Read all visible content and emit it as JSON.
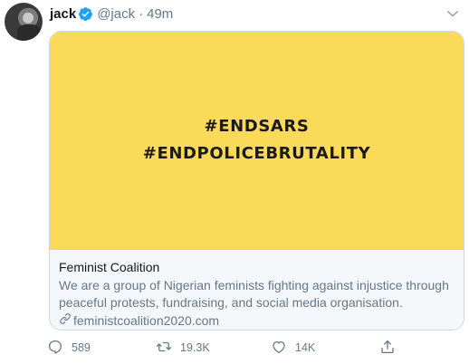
{
  "tweet": {
    "author_name": "jack",
    "handle": "@jack",
    "separator": "·",
    "time": "49m"
  },
  "card": {
    "image_lines": [
      "#ENDSARS",
      "#ENDPOLICEBRUTALITY"
    ],
    "image_bg": "#fbda5a",
    "title": "Feminist Coalition",
    "description_line1": "We are a group of Nigerian feminists fighting against injustice through",
    "description_line2": "peaceful protests, fundraising, and social media organisation.",
    "link": "feministcoalition2020.com"
  },
  "actions": {
    "reply_count": "589",
    "retweet_count": "19.3K",
    "like_count": "14K"
  },
  "icons": {
    "verified": "verified-badge-icon",
    "caret": "chevron-down-icon",
    "link": "link-icon",
    "reply": "reply-icon",
    "retweet": "retweet-icon",
    "like": "heart-icon",
    "share": "share-icon"
  },
  "colors": {
    "accent": "#1da1f2",
    "muted": "#657786",
    "card_bg": "#f5f8fa"
  }
}
